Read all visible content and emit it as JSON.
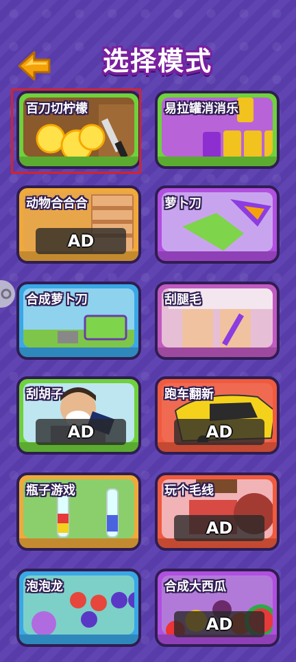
{
  "header": {
    "title": "选择模式",
    "back_icon": "arrow-left-icon",
    "accent": "#f5a20a"
  },
  "modes": [
    {
      "label": "百刀切柠檬",
      "ad": "",
      "selected": true,
      "bg": "#8a5a2c",
      "rim": "#6fd13c"
    },
    {
      "label": "易拉罐消消乐",
      "ad": "",
      "selected": false,
      "bg": "#b864d8",
      "rim": "#6fd13c"
    },
    {
      "label": "动物合合合",
      "ad": "AD",
      "selected": false,
      "bg": "#e8a64a",
      "rim": "#f0a93a"
    },
    {
      "label": "萝卜刀",
      "ad": "",
      "selected": false,
      "bg": "#c9a4ee",
      "rim": "#b04fe0"
    },
    {
      "label": "合成萝卜刀",
      "ad": "",
      "selected": false,
      "bg": "#8fd2ee",
      "rim": "#3aa7e6"
    },
    {
      "label": "刮腿毛",
      "ad": "",
      "selected": false,
      "bg": "#e6bfd6",
      "rim": "#c05ac0"
    },
    {
      "label": "刮胡子",
      "ad": "AD",
      "selected": false,
      "bg": "#bde6f0",
      "rim": "#6fd13c"
    },
    {
      "label": "跑车翻新",
      "ad": "AD",
      "selected": false,
      "bg": "#f06a52",
      "rim": "#f05a3e"
    },
    {
      "label": "瓶子游戏",
      "ad": "",
      "selected": false,
      "bg": "#8bcf6d",
      "rim": "#f0a93a"
    },
    {
      "label": "玩个毛线",
      "ad": "AD",
      "selected": false,
      "bg": "#f1b3b6",
      "rim": "#f05a3e"
    },
    {
      "label": "泡泡龙",
      "ad": "",
      "selected": false,
      "bg": "#7cd0c8",
      "rim": "#3aa7e6"
    },
    {
      "label": "合成大西瓜",
      "ad": "AD",
      "selected": false,
      "bg": "#b27ad8",
      "rim": "#b04fe0"
    }
  ]
}
